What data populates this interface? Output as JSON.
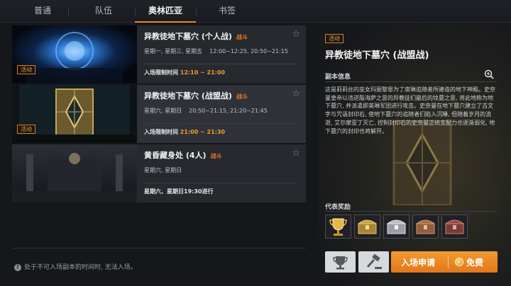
{
  "tabs": [
    {
      "label": "普通",
      "active": false
    },
    {
      "label": "队伍",
      "active": false
    },
    {
      "label": "奥林匹亚",
      "active": true
    },
    {
      "label": "书签",
      "active": false
    }
  ],
  "dungeons": [
    {
      "tag": "活动",
      "title": "异教徒地下墓穴 (个人战)",
      "badge": "战斗",
      "days": "星期一, 星期三, 星期五",
      "hours": "12:00~12:25, 20:50~21:15",
      "time_label": "入场限制时间",
      "time_value": "12:10 ~ 21:00"
    },
    {
      "tag": "活动",
      "title": "异教徒地下墓穴 (战盟战)",
      "badge": "战斗",
      "days": "星期六, 星期日",
      "hours": "20:50~21:15, 21:20~21:45",
      "time_label": "入场限制时间",
      "time_value": "21:00 ~ 21:30"
    },
    {
      "tag": "",
      "title": "黄昏藏身处 (4人)",
      "badge": "战斗",
      "days": "星期六, 星期日",
      "hours": "",
      "time_label": "星期六、星期日19:30进行",
      "time_value": ""
    }
  ],
  "notice": "处于不可入场副本的时间时, 无法入场。",
  "detail": {
    "tag": "活动",
    "title": "异教徒地下墓穴 (战盟战)",
    "section_info": "副本信息",
    "description": "这是莉莉丝的巫女玛丽黎恩为了席琳追随者所建造的地下神殿。史奈曼皇帝以违逆殷海萨之意的异教徒们最后的坟墓之意, 将此地称为地下墓穴, 并派遣即美琳军团进行攻击。史奈曼在地下墓穴建立了古文字与咒语封印石, 使地下墓穴的追随者们陷入沉睡, 但随着岁月的流逝, 艾尔摩亚丁灭亡, 控制封印石的史奈曼正统支配力也逐渐弱化, 地下墓穴的封印也将解开。",
    "section_reward": "代表奖励",
    "rewards": [
      "trophy",
      "gold-chest",
      "silver-chest",
      "bronze-chest",
      "red-chest"
    ],
    "enter_label": "入场申请",
    "free_label": "免费"
  },
  "colors": {
    "accent": "#f08a1c",
    "tag_border": "#e07a1a",
    "time_highlight": "#f29a2e"
  }
}
